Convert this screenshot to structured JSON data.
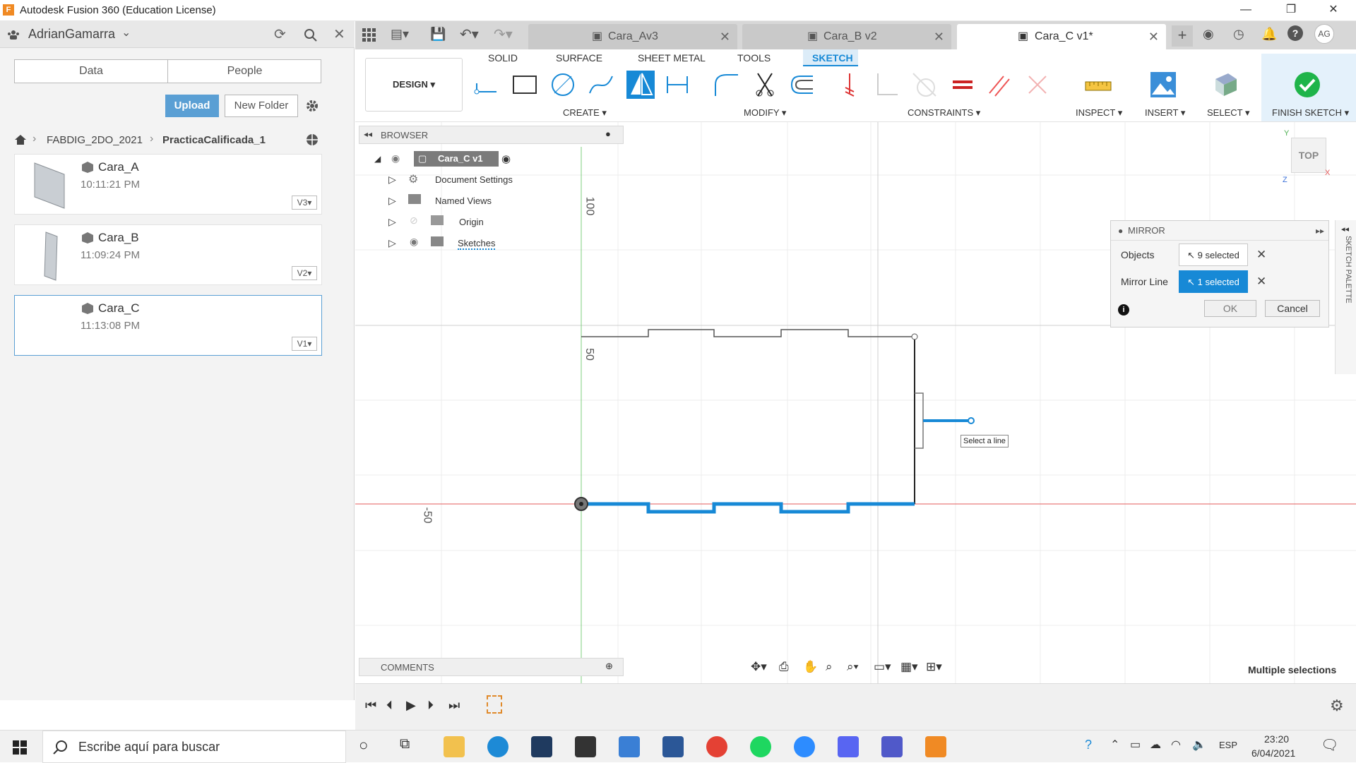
{
  "window": {
    "title": "Autodesk Fusion 360 (Education License)",
    "logo": "F"
  },
  "data_panel": {
    "user": "AdrianGamarra",
    "tabs": [
      "Data",
      "People"
    ],
    "upload_label": "Upload",
    "new_folder_label": "New Folder",
    "breadcrumb": [
      "FABDIG_2DO_2021",
      "PracticaCalificada_1"
    ],
    "files": [
      {
        "name": "Cara_A",
        "time": "10:11:21 PM",
        "version": "V3▾"
      },
      {
        "name": "Cara_B",
        "time": "11:09:24 PM",
        "version": "V2▾"
      },
      {
        "name": "Cara_C",
        "time": "11:13:08 PM",
        "version": "V1▾"
      }
    ]
  },
  "doc_tabs": [
    {
      "label": "Cara_Av3",
      "active": false
    },
    {
      "label": "Cara_B v2",
      "active": false
    },
    {
      "label": "Cara_C v1*",
      "active": true
    }
  ],
  "user_initials": "AG",
  "toolbar": {
    "workspace": "DESIGN ▾",
    "tabs": [
      "SOLID",
      "SURFACE",
      "SHEET METAL",
      "TOOLS",
      "SKETCH"
    ],
    "active_tab": "SKETCH",
    "groups": {
      "create": "CREATE ▾",
      "modify": "MODIFY ▾",
      "constraints": "CONSTRAINTS ▾",
      "inspect": "INSPECT ▾",
      "insert": "INSERT ▾",
      "select": "SELECT ▾",
      "finish": "FINISH SKETCH ▾"
    },
    "accent": "#1789d6"
  },
  "browser": {
    "title": "BROWSER",
    "root": "Cara_C v1",
    "items": [
      "Document Settings",
      "Named Views",
      "Origin",
      "Sketches"
    ]
  },
  "viewcube": {
    "label": "TOP",
    "axis_y": "Y",
    "axis_x": "X",
    "axis_z": "Z"
  },
  "canvas": {
    "ruler_labels": [
      "100",
      "50",
      "-50"
    ],
    "tooltip": "Select a line",
    "status": "Multiple selections"
  },
  "mirror_dialog": {
    "title": "MIRROR",
    "objects_label": "Objects",
    "objects_value": "9 selected",
    "mirror_line_label": "Mirror Line",
    "mirror_line_value": "1 selected",
    "ok": "OK",
    "cancel": "Cancel",
    "side_palette": "SKETCH PALETTE"
  },
  "comments_label": "COMMENTS",
  "taskbar": {
    "search_placeholder": "Escribe aquí para buscar",
    "language": "ESP",
    "time": "23:20",
    "date": "6/04/2021"
  }
}
